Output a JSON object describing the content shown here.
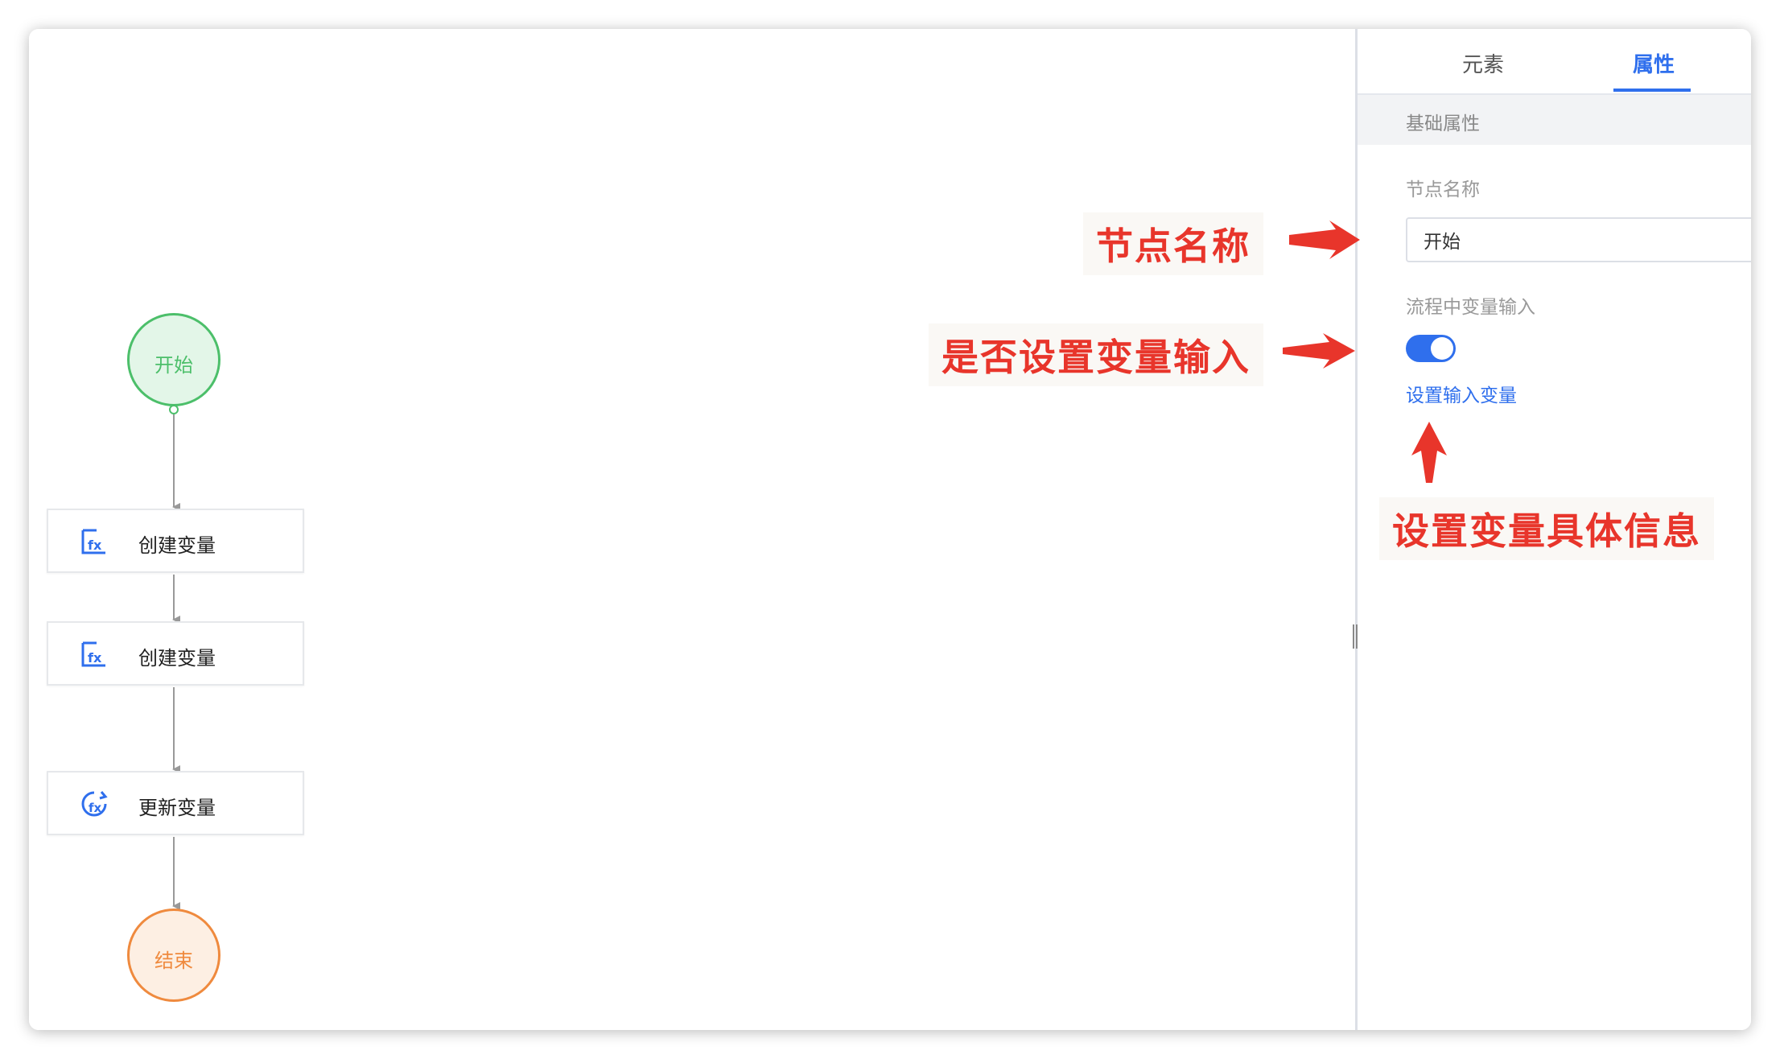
{
  "tabs": [
    {
      "label": "元素",
      "active": false
    },
    {
      "label": "属性",
      "active": true
    }
  ],
  "properties": {
    "section_title": "基础属性",
    "node_name_label": "节点名称",
    "node_name_value": "开始",
    "variable_input_label": "流程中变量输入",
    "variable_input_enabled": true,
    "set_input_link": "设置输入变量"
  },
  "flow": {
    "start_label": "开始",
    "end_label": "结束",
    "nodes": [
      {
        "label": "创建变量",
        "icon": "create-variable-icon"
      },
      {
        "label": "创建变量",
        "icon": "create-variable-icon"
      },
      {
        "label": "更新变量",
        "icon": "update-variable-icon"
      }
    ]
  },
  "annotations": {
    "node_name": "节点名称",
    "variable_input": "是否设置变量输入",
    "variable_detail": "设置变量具体信息"
  },
  "colors": {
    "accent": "#2f6fed",
    "start": "#4cbf6a",
    "end": "#ef8a3e",
    "annotation": "#e8352b"
  }
}
